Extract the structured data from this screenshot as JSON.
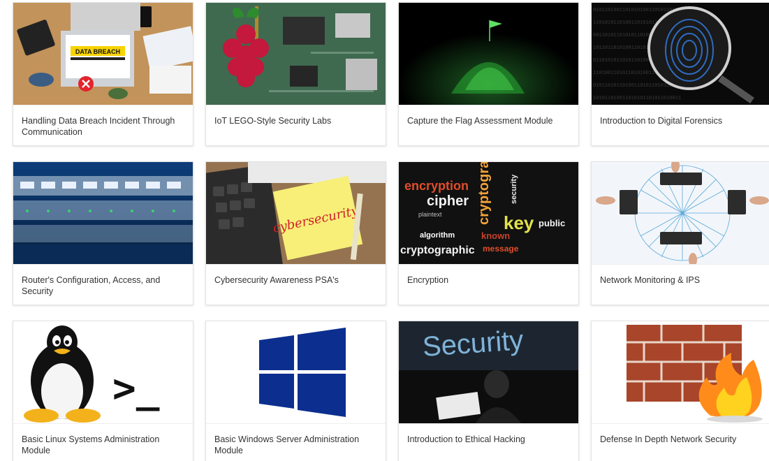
{
  "courses": [
    {
      "title": "Handling Data Breach Incident Through Communication",
      "image_icon": "data-breach-image",
      "badge": "DATA BREACH"
    },
    {
      "title": "IoT LEGO-Style Security Labs",
      "image_icon": "raspberry-pi-image"
    },
    {
      "title": "Capture the Flag Assessment Module",
      "image_icon": "flag-on-hill-image"
    },
    {
      "title": "Introduction to Digital Forensics",
      "image_icon": "fingerprint-magnifier-image"
    },
    {
      "title": "Router's Configuration, Access, and Security",
      "image_icon": "server-rack-image"
    },
    {
      "title": "Cybersecurity Awareness PSA's",
      "image_icon": "sticky-note-keyboard-image",
      "note_text": "cybersecurity"
    },
    {
      "title": "Encryption",
      "image_icon": "word-cloud-image",
      "words": [
        "encryption",
        "cipher",
        "key",
        "cryptographic",
        "cryptography",
        "algorithm",
        "known",
        "security",
        "plaintext",
        "message",
        "public"
      ]
    },
    {
      "title": "Network Monitoring & IPS",
      "image_icon": "network-hands-image"
    },
    {
      "title": "Basic Linux Systems Administration Module",
      "image_icon": "linux-penguin-terminal-image",
      "prompt_text": ">_"
    },
    {
      "title": "Basic Windows Server Administration Module",
      "image_icon": "windows-logo-image"
    },
    {
      "title": "Introduction to Ethical Hacking",
      "image_icon": "hacker-security-image",
      "banner_text": "Security"
    },
    {
      "title": "Defense In Depth Network Security",
      "image_icon": "firewall-flame-image"
    }
  ],
  "colors": {
    "caption_text": "#333333",
    "card_border": "#e3e3e3",
    "windows_blue": "#0c2f8f"
  }
}
